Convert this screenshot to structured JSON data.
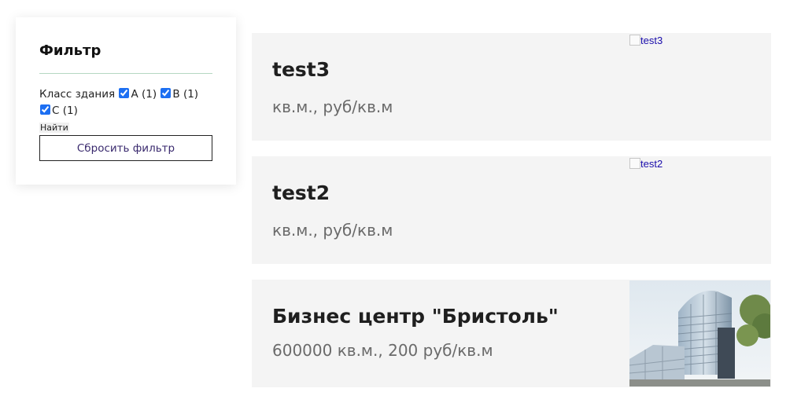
{
  "filter": {
    "title": "Фильтр",
    "class_label": "Класс здания",
    "options": [
      {
        "label": "A (1)",
        "checked": true
      },
      {
        "label": "B (1)",
        "checked": true
      },
      {
        "label": "C (1)",
        "checked": true
      }
    ],
    "find_label": "Найти",
    "reset_label": "Сбросить фильтр"
  },
  "listings": [
    {
      "title": "test3",
      "meta": "кв.м., руб/кв.м",
      "image_alt": "test3"
    },
    {
      "title": "test2",
      "meta": "кв.м., руб/кв.м",
      "image_alt": "test2"
    },
    {
      "title": "Бизнес центр \"Бристоль\"",
      "meta": "600000 кв.м., 200 руб/кв.м"
    }
  ],
  "colors": {
    "accent_checkbox": "#1d6ff2",
    "card_bg": "#f4f4f4",
    "link": "#1a0dab",
    "divider": "#b5d8c2"
  }
}
